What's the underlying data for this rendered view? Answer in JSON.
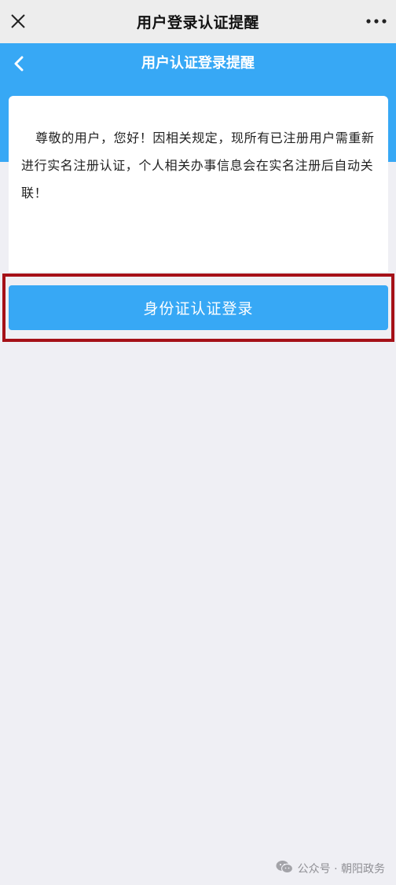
{
  "wechat_bar": {
    "title": "用户登录认证提醒",
    "close_icon": "close-icon",
    "more_icon": "more-dots-icon"
  },
  "header": {
    "title": "用户认证登录提醒",
    "back_icon": "chevron-left-icon"
  },
  "notice": {
    "text": "尊敬的用户，您好！因相关规定，现所有已注册用户需重新进行实名注册认证，个人相关办事信息会在实名注册后自动关联！"
  },
  "login_button": {
    "label": "身份证认证登录"
  },
  "watermark": {
    "text": "公众号 · 朝阳政务",
    "icon": "wechat-icon"
  },
  "colors": {
    "brand_blue": "#37a8f5",
    "highlight_red": "#a51118",
    "background": "#efeff4"
  }
}
